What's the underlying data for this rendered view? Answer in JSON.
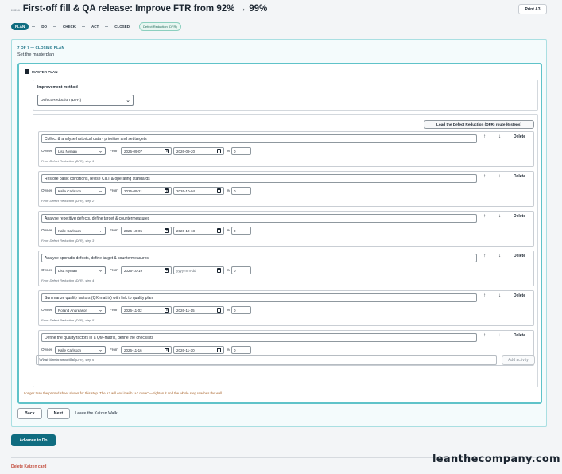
{
  "header": {
    "card_id": "K-094",
    "title": "First-off fill & QA release: Improve FTR from 92% → 99%",
    "print_label": "Print A3"
  },
  "phases": [
    "PLAN",
    "DO",
    "CHECK",
    "ACT",
    "CLOSED"
  ],
  "active_phase": "PLAN",
  "method_badge": "Defect Reduction (DFR)",
  "step": {
    "label": "7 OF 7 — CLOSING PLAN",
    "title": "Set the masterplan"
  },
  "master": {
    "toggle": "−",
    "label": "MASTER PLAN",
    "method_label": "Improvement method",
    "method_value": "Defect Reduction (DFR)",
    "load_label": "Load the Defect Reduction (DFR) route (6 steps)"
  },
  "labels": {
    "owner": "Owner",
    "from": "From",
    "to": "To",
    "pct": "%",
    "delete": "Delete",
    "up": "↑",
    "down": "↓",
    "new_placeholder": "What the team will do",
    "add": "Add activity"
  },
  "rows": [
    {
      "activity": "Collect & analyse historical data - prioritise and set targets",
      "owner": "Lisa Nyman",
      "from": "2026-09-07",
      "to": "2026-09-20",
      "pct": "0",
      "source": "From Defect Reduction (DFR), step 1"
    },
    {
      "activity": "Restore basic conditions, revise CILT & operating standards",
      "owner": "Kalle Carlsson",
      "from": "2026-09-21",
      "to": "2026-10-04",
      "pct": "0",
      "source": "From Defect Reduction (DFR), step 2"
    },
    {
      "activity": "Analyse repetitive defects, define target & countermeasures",
      "owner": "Kalle Carlsson",
      "from": "2026-10-05",
      "to": "2026-10-18",
      "pct": "0",
      "source": "From Defect Reduction (DFR), step 3"
    },
    {
      "activity": "Analyse sporadic defects, define target & countermeasures",
      "owner": "Lisa Nyman",
      "from": "2026-10-19",
      "to": "yyyy-mm-dd",
      "pct": "0",
      "source": "From Defect Reduction (DFR), step 4"
    },
    {
      "activity": "Summarize quality factors (QX-matrix) with link to quality plan",
      "owner": "Roland Andreason",
      "from": "2026-11-02",
      "to": "2026-11-15",
      "pct": "0",
      "source": "From Defect Reduction (DFR), step 5"
    },
    {
      "activity": "Define the quality factors in a QM-matrix, define the checklists",
      "owner": "Kalle Carlsson",
      "from": "2026-11-16",
      "to": "2026-11-30",
      "pct": "0",
      "source": "From Defect Reduction (DFR), step 6"
    }
  ],
  "warning": "Longer than the printed sheet shows for this step. The A3 will end it with \"+3 more\" — tighten it and the whole step reaches the wall.",
  "nav": {
    "back": "Back",
    "next": "Next",
    "leave": "Leave the Kaizen Walk"
  },
  "advance_label": "Advance to Do",
  "delete_card": "Delete Kaizen card",
  "brand": "leanthecompany.com"
}
